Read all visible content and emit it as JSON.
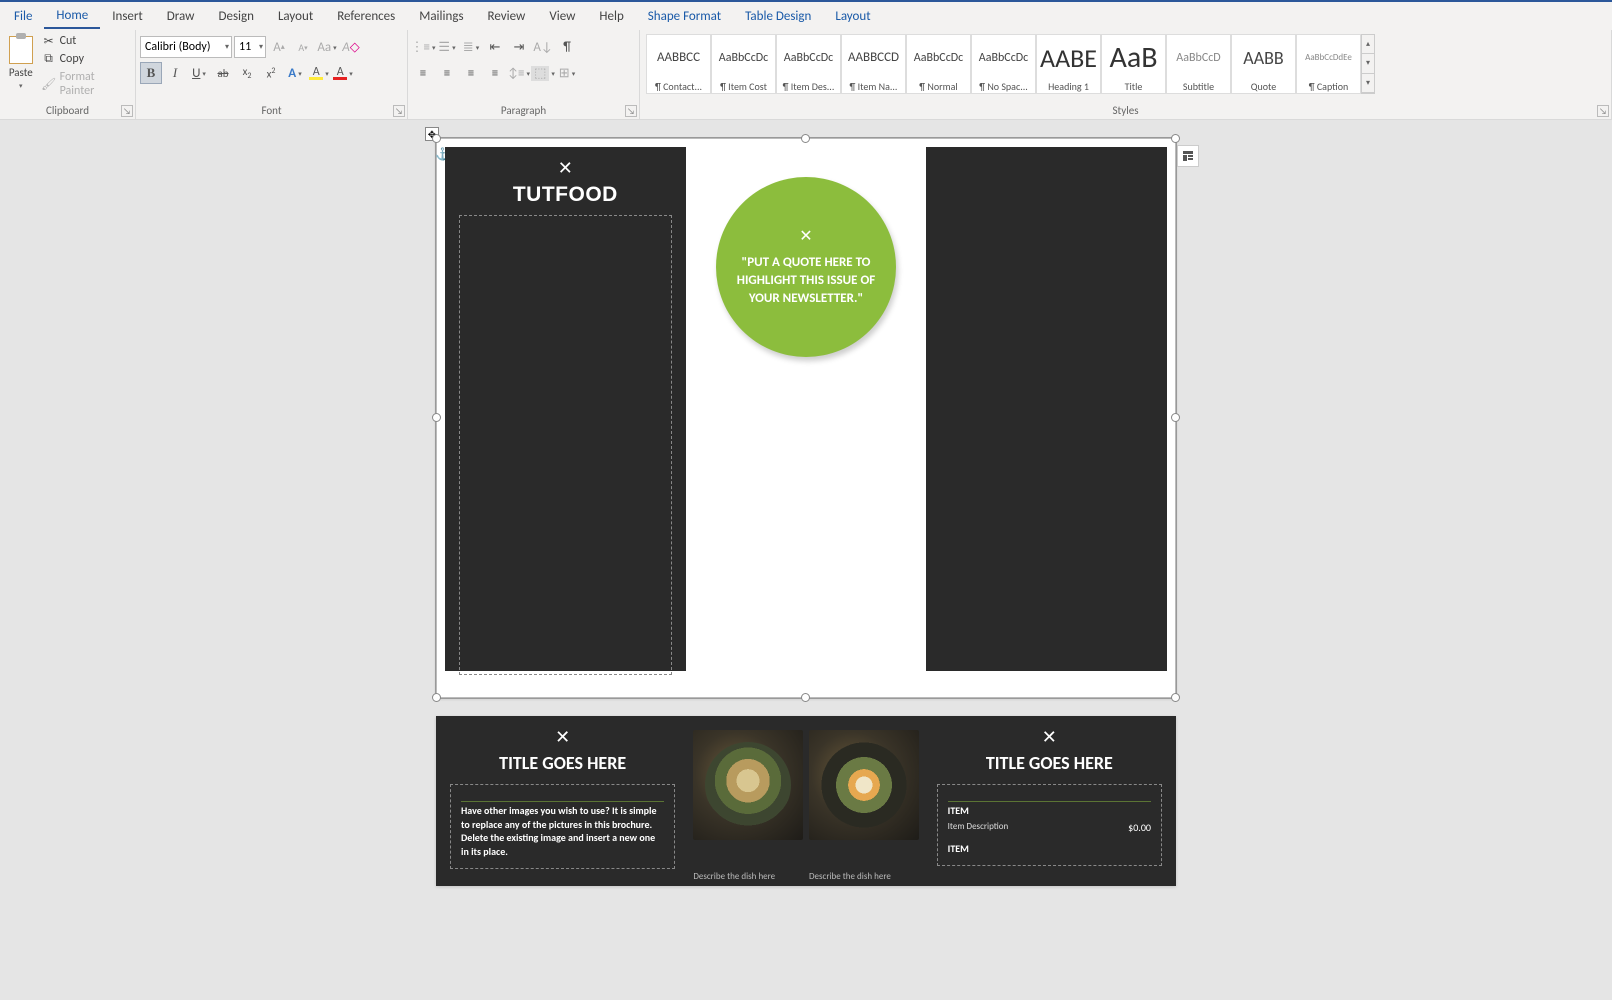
{
  "menu": {
    "file": "File",
    "home": "Home",
    "insert": "Insert",
    "draw": "Draw",
    "design": "Design",
    "layout": "Layout",
    "references": "References",
    "mailings": "Mailings",
    "review": "Review",
    "view": "View",
    "help": "Help",
    "shape_format": "Shape Format",
    "table_design": "Table Design",
    "layout2": "Layout"
  },
  "clipboard": {
    "paste": "Paste",
    "cut": "Cut",
    "copy": "Copy",
    "format_painter": "Format Painter",
    "group": "Clipboard"
  },
  "font": {
    "name": "Calibri (Body)",
    "size": "11",
    "group": "Font"
  },
  "paragraph": {
    "group": "Paragraph"
  },
  "styles": {
    "group": "Styles",
    "items": [
      {
        "preview": "AABBCC",
        "name": "¶ Contact..."
      },
      {
        "preview": "AaBbCcDc",
        "name": "¶ Item Cost"
      },
      {
        "preview": "AaBbCcDc",
        "name": "¶ Item Des..."
      },
      {
        "preview": "AABBCCD",
        "name": "¶ Item Na..."
      },
      {
        "preview": "AaBbCcDc",
        "name": "¶ Normal"
      },
      {
        "preview": "AaBbCcDc",
        "name": "¶ No Spac..."
      },
      {
        "preview": "AABE",
        "name": "Heading 1"
      },
      {
        "preview": "AaB",
        "name": "Title"
      },
      {
        "preview": "AaBbCcD",
        "name": "Subtitle"
      },
      {
        "preview": "AABB",
        "name": "Quote"
      },
      {
        "preview": "AaBbCcDdEe",
        "name": "¶ Caption"
      }
    ]
  },
  "doc": {
    "p1": {
      "logo_title": "TUTFOOD",
      "quote": "\"PUT A QUOTE HERE TO HIGHLIGHT THIS ISSUE OF YOUR NEWSLETTER.\""
    },
    "p2": {
      "title_left": "TITLE GOES HERE",
      "title_right": "TITLE GOES HERE",
      "body_left": "Have other images you wish to use?  It is simple to replace any of the pictures in this brochure. Delete the existing image and insert a new one in its place.",
      "caption1": "Describe the dish here",
      "caption2": "Describe the dish here",
      "item_label": "ITEM",
      "item_desc": "Item Description",
      "item_price": "$0.00",
      "item_label2": "ITEM"
    }
  }
}
